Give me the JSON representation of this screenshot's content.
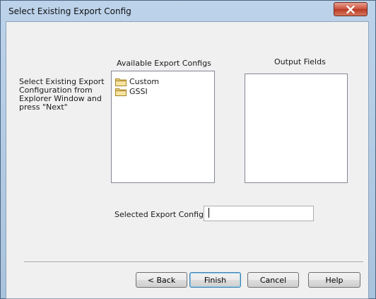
{
  "window": {
    "title": "Select Existing Export Config"
  },
  "instructions": "Select Existing Export Configuration from Explorer Window and press \"Next\"",
  "available_configs": {
    "label": "Available Export Configs",
    "items": [
      {
        "label": "Custom",
        "icon": "folder-icon"
      },
      {
        "label": "GSSI",
        "icon": "folder-icon"
      }
    ]
  },
  "output_fields": {
    "label": "Output Fields",
    "items": []
  },
  "selected_config": {
    "label": "Selected Export Config:",
    "value": ""
  },
  "buttons": {
    "back": "< Back",
    "finish": "Finish",
    "cancel": "Cancel",
    "help": "Help"
  }
}
